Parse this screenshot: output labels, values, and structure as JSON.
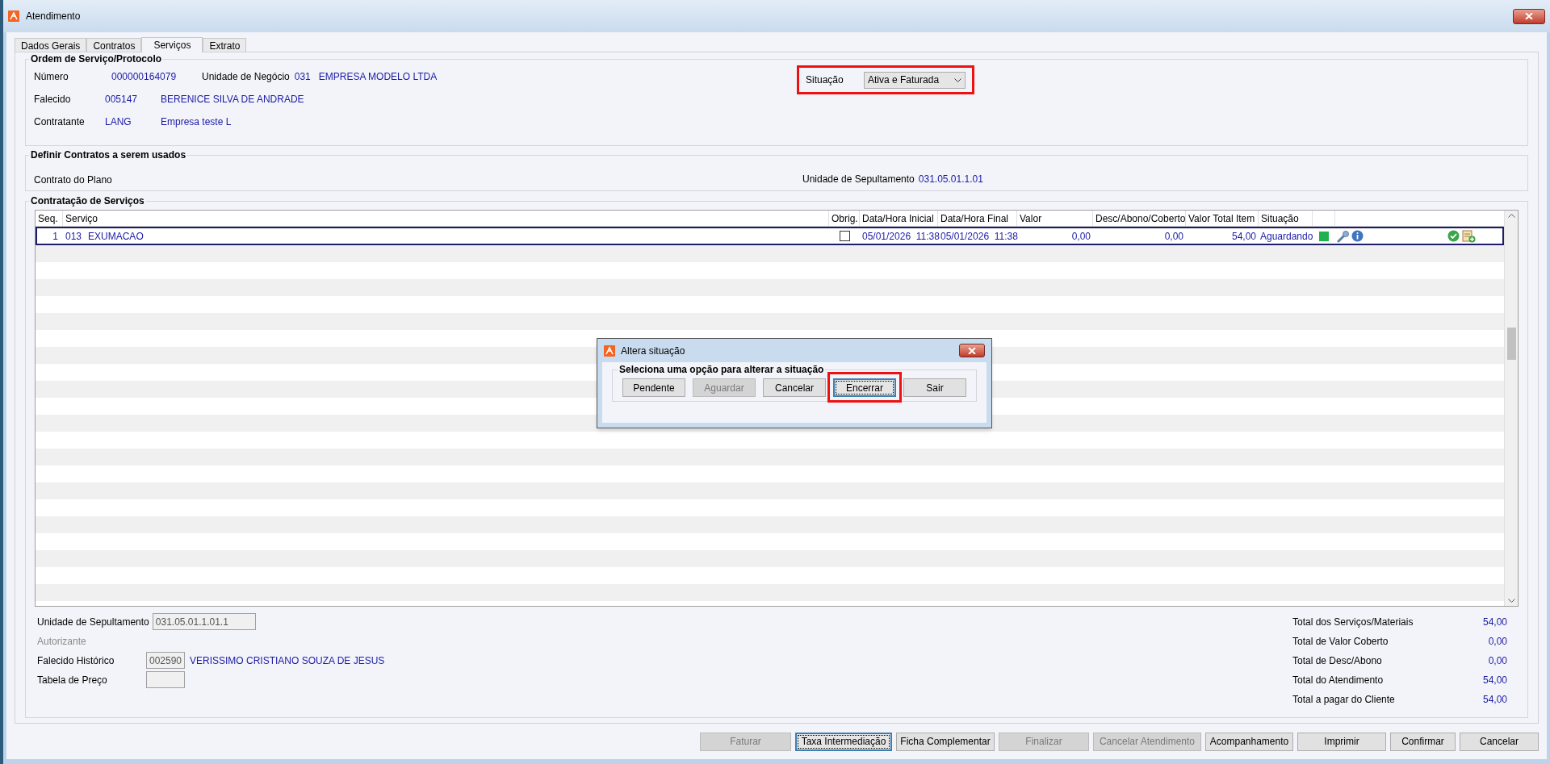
{
  "window": {
    "title": "Atendimento"
  },
  "tabs": [
    {
      "label": "Dados Gerais",
      "selected": false
    },
    {
      "label": "Contratos",
      "selected": false
    },
    {
      "label": "Serviços",
      "selected": true
    },
    {
      "label": "Extrato",
      "selected": false
    }
  ],
  "ordem": {
    "title": "Ordem de Serviço/Protocolo",
    "numero": {
      "label": "Número",
      "value": "000000164079"
    },
    "unidade_negocio": {
      "label": "Unidade de Negócio",
      "code": "031",
      "name": "EMPRESA MODELO LTDA"
    },
    "falecido": {
      "label": "Falecido",
      "code": "005147",
      "name": "BERENICE SILVA DE ANDRADE"
    },
    "contratante": {
      "label": "Contratante",
      "code": "LANG",
      "name": "Empresa teste L"
    },
    "situacao": {
      "label": "Situação",
      "value": "Ativa e Faturada",
      "highlighted": true
    }
  },
  "contratos": {
    "title": "Definir Contratos a serem usados",
    "contrato_label": "Contrato do Plano",
    "unidade_label": "Unidade de Sepultamento",
    "unidade_value": "031.05.01.1.01"
  },
  "servicos": {
    "title": "Contratação de Serviços",
    "columns": [
      "Seq.",
      "Serviço",
      "Obrig.",
      "Data/Hora Inicial",
      "Data/Hora Final",
      "Valor",
      "Desc/Abono/Coberto",
      "Valor Total Item",
      "Situação"
    ],
    "rows": [
      {
        "seq": "1",
        "code": "013",
        "name": "EXUMACAO",
        "obrig": false,
        "inicio": "05/01/2026  11:38",
        "fim": "05/01/2026  11:38",
        "valor": "0,00",
        "desconto": "0,00",
        "total": "54,00",
        "situacao": "Aguardando",
        "color": "#22b14c",
        "selected": true
      }
    ]
  },
  "detalhes": {
    "unidade": {
      "label": "Unidade de Sepultamento",
      "value": "031.05.01.1.01.1"
    },
    "autorizante": {
      "label": "Autorizante"
    },
    "falecido_historico": {
      "label": "Falecido Histórico",
      "code": "002590",
      "name": "VERISSIMO CRISTIANO SOUZA DE JESUS"
    },
    "tabela_preco": {
      "label": "Tabela de Preço"
    }
  },
  "totals": [
    {
      "label": "Total dos Serviços/Materiais",
      "value": "54,00"
    },
    {
      "label": "Total de Valor Coberto",
      "value": "0,00"
    },
    {
      "label": "Total de Desc/Abono",
      "value": "0,00"
    },
    {
      "label": "Total do Atendimento",
      "value": "54,00"
    },
    {
      "label": "Total a pagar do Cliente",
      "value": "54,00"
    }
  ],
  "buttons": [
    {
      "label": "Faturar",
      "disabled": true,
      "focused": false
    },
    {
      "label": "Taxa Intermediação",
      "disabled": false,
      "focused": true
    },
    {
      "label": "Ficha Complementar",
      "disabled": false,
      "focused": false
    },
    {
      "label": "Finalizar",
      "disabled": true,
      "focused": false
    },
    {
      "label": "Cancelar Atendimento",
      "disabled": true,
      "focused": false
    },
    {
      "label": "Acompanhamento",
      "disabled": false,
      "focused": false
    },
    {
      "label": "Imprimir",
      "disabled": false,
      "focused": false
    },
    {
      "label": "Confirmar",
      "disabled": false,
      "focused": false
    },
    {
      "label": "Cancelar",
      "disabled": false,
      "focused": false
    }
  ],
  "dialog": {
    "title": "Altera situação",
    "group_title": "Seleciona uma opção para alterar a situação",
    "buttons": [
      {
        "label": "Pendente",
        "disabled": false,
        "focused": false,
        "highlighted": false
      },
      {
        "label": "Aguardar",
        "disabled": true,
        "focused": false,
        "highlighted": false
      },
      {
        "label": "Cancelar",
        "disabled": false,
        "focused": false,
        "highlighted": false
      },
      {
        "label": "Encerrar",
        "disabled": false,
        "focused": true,
        "highlighted": true
      },
      {
        "label": "Sair",
        "disabled": false,
        "focused": false,
        "highlighted": false
      }
    ]
  }
}
